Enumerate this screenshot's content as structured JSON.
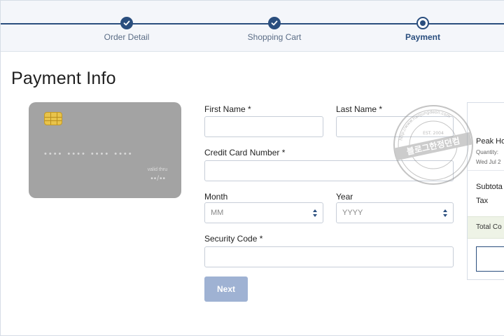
{
  "stepper": {
    "steps": [
      {
        "label": "Order Detail",
        "state": "complete"
      },
      {
        "label": "Shopping Cart",
        "state": "complete"
      },
      {
        "label": "Payment",
        "state": "current"
      }
    ]
  },
  "page": {
    "title": "Payment Info"
  },
  "card": {
    "number_mask": [
      "••••",
      "••••",
      "••••",
      "••••"
    ],
    "valid_thru_label": "valid thru",
    "valid_thru_mask": "••/••"
  },
  "form": {
    "first_name_label": "First Name *",
    "first_name_value": "",
    "last_name_label": "Last Name *",
    "last_name_value": "",
    "card_number_label": "Credit Card Number *",
    "card_number_value": "",
    "month_label": "Month",
    "month_selected": "MM",
    "year_label": "Year",
    "year_selected": "YYYY",
    "security_code_label": "Security Code *",
    "security_code_value": "",
    "next_label": "Next"
  },
  "summary": {
    "item_title": "Peak Ho",
    "item_quantity": "Quantity:",
    "item_date": "Wed Jul 2",
    "subtotal_label": "Subtota",
    "tax_label": "Tax",
    "total_label": "Total Co"
  },
  "watermark": {
    "text_main": "블로그한정던컴",
    "text_top": "http://www.hanjungdeon.com",
    "text_est": "EST. 2004"
  },
  "colors": {
    "primary": "#2a4e7e",
    "button_disabled": "#9fb2d3",
    "card_bg": "#a3a3a3",
    "chip": "#e8c34a",
    "total_bar": "#eef3e6"
  }
}
